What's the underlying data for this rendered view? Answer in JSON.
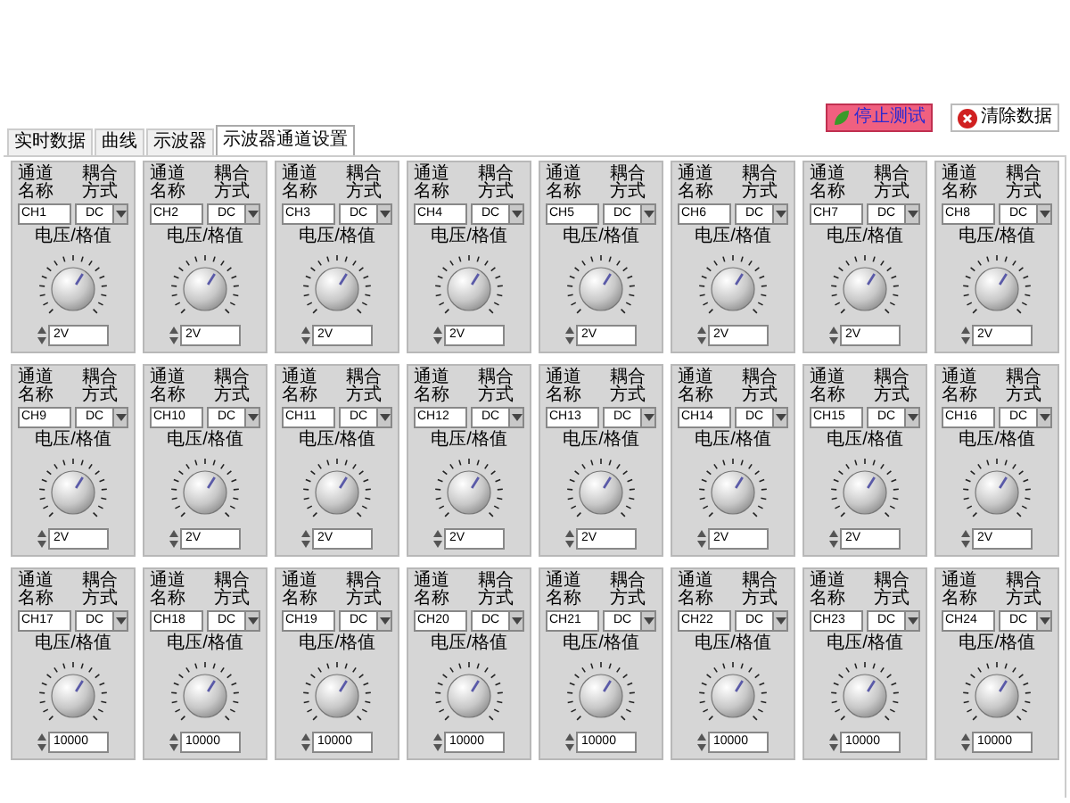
{
  "tabs": [
    {
      "label": "实时数据",
      "selected": false
    },
    {
      "label": "曲线",
      "selected": false
    },
    {
      "label": "示波器",
      "selected": false
    },
    {
      "label": "示波器通道设置",
      "selected": true
    }
  ],
  "buttons": [
    {
      "label": "停止测试",
      "kind": "stop"
    },
    {
      "label": "清除数据",
      "kind": "clear"
    }
  ],
  "channels": [
    {
      "name_label": "通道名称",
      "coupling_label": "耦合方式",
      "name": "CH1",
      "coupling": "DC",
      "scale_label": "电压/格值",
      "value": "2V"
    },
    {
      "name_label": "通道名称",
      "coupling_label": "耦合方式",
      "name": "CH2",
      "coupling": "DC",
      "scale_label": "电压/格值",
      "value": "2V"
    },
    {
      "name_label": "通道名称",
      "coupling_label": "耦合方式",
      "name": "CH3",
      "coupling": "DC",
      "scale_label": "电压/格值",
      "value": "2V"
    },
    {
      "name_label": "通道名称",
      "coupling_label": "耦合方式",
      "name": "CH4",
      "coupling": "DC",
      "scale_label": "电压/格值",
      "value": "2V"
    },
    {
      "name_label": "通道名称",
      "coupling_label": "耦合方式",
      "name": "CH5",
      "coupling": "DC",
      "scale_label": "电压/格值",
      "value": "2V"
    },
    {
      "name_label": "通道名称",
      "coupling_label": "耦合方式",
      "name": "CH6",
      "coupling": "DC",
      "scale_label": "电压/格值",
      "value": "2V"
    },
    {
      "name_label": "通道名称",
      "coupling_label": "耦合方式",
      "name": "CH7",
      "coupling": "DC",
      "scale_label": "电压/格值",
      "value": "2V"
    },
    {
      "name_label": "通道名称",
      "coupling_label": "耦合方式",
      "name": "CH8",
      "coupling": "DC",
      "scale_label": "电压/格值",
      "value": "2V"
    },
    {
      "name_label": "通道名称",
      "coupling_label": "耦合方式",
      "name": "CH9",
      "coupling": "DC",
      "scale_label": "电压/格值",
      "value": "2V"
    },
    {
      "name_label": "通道名称",
      "coupling_label": "耦合方式",
      "name": "CH10",
      "coupling": "DC",
      "scale_label": "电压/格值",
      "value": "2V"
    },
    {
      "name_label": "通道名称",
      "coupling_label": "耦合方式",
      "name": "CH11",
      "coupling": "DC",
      "scale_label": "电压/格值",
      "value": "2V"
    },
    {
      "name_label": "通道名称",
      "coupling_label": "耦合方式",
      "name": "CH12",
      "coupling": "DC",
      "scale_label": "电压/格值",
      "value": "2V"
    },
    {
      "name_label": "通道名称",
      "coupling_label": "耦合方式",
      "name": "CH13",
      "coupling": "DC",
      "scale_label": "电压/格值",
      "value": "2V"
    },
    {
      "name_label": "通道名称",
      "coupling_label": "耦合方式",
      "name": "CH14",
      "coupling": "DC",
      "scale_label": "电压/格值",
      "value": "2V"
    },
    {
      "name_label": "通道名称",
      "coupling_label": "耦合方式",
      "name": "CH15",
      "coupling": "DC",
      "scale_label": "电压/格值",
      "value": "2V"
    },
    {
      "name_label": "通道名称",
      "coupling_label": "耦合方式",
      "name": "CH16",
      "coupling": "DC",
      "scale_label": "电压/格值",
      "value": "2V"
    },
    {
      "name_label": "通道名称",
      "coupling_label": "耦合方式",
      "name": "CH17",
      "coupling": "DC",
      "scale_label": "电压/格值",
      "value": "10000"
    },
    {
      "name_label": "通道名称",
      "coupling_label": "耦合方式",
      "name": "CH18",
      "coupling": "DC",
      "scale_label": "电压/格值",
      "value": "10000"
    },
    {
      "name_label": "通道名称",
      "coupling_label": "耦合方式",
      "name": "CH19",
      "coupling": "DC",
      "scale_label": "电压/格值",
      "value": "10000"
    },
    {
      "name_label": "通道名称",
      "coupling_label": "耦合方式",
      "name": "CH20",
      "coupling": "DC",
      "scale_label": "电压/格值",
      "value": "10000"
    },
    {
      "name_label": "通道名称",
      "coupling_label": "耦合方式",
      "name": "CH21",
      "coupling": "DC",
      "scale_label": "电压/格值",
      "value": "10000"
    },
    {
      "name_label": "通道名称",
      "coupling_label": "耦合方式",
      "name": "CH22",
      "coupling": "DC",
      "scale_label": "电压/格值",
      "value": "10000"
    },
    {
      "name_label": "通道名称",
      "coupling_label": "耦合方式",
      "name": "CH23",
      "coupling": "DC",
      "scale_label": "电压/格值",
      "value": "10000"
    },
    {
      "name_label": "通道名称",
      "coupling_label": "耦合方式",
      "name": "CH24",
      "coupling": "DC",
      "scale_label": "电压/格值",
      "value": "10000"
    }
  ]
}
